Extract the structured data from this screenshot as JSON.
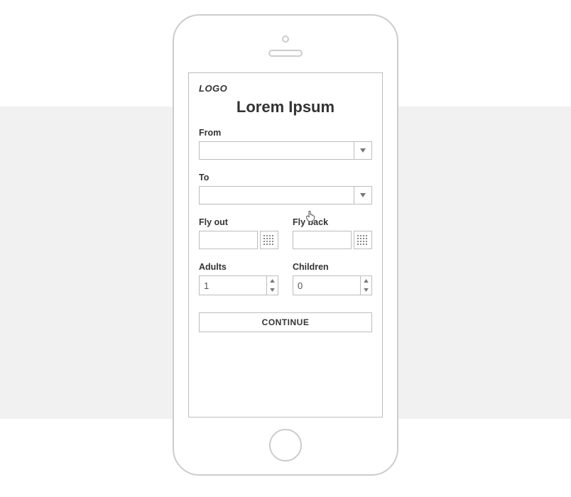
{
  "logo": "LOGO",
  "title": "Lorem Ipsum",
  "labels": {
    "from": "From",
    "to": "To",
    "fly_out": "Fly out",
    "fly_back": "Fly back",
    "adults": "Adults",
    "children": "Children"
  },
  "values": {
    "from": "",
    "to": "",
    "fly_out": "",
    "fly_back": "",
    "adults": "1",
    "children": "0"
  },
  "buttons": {
    "continue": "CONTINUE"
  }
}
